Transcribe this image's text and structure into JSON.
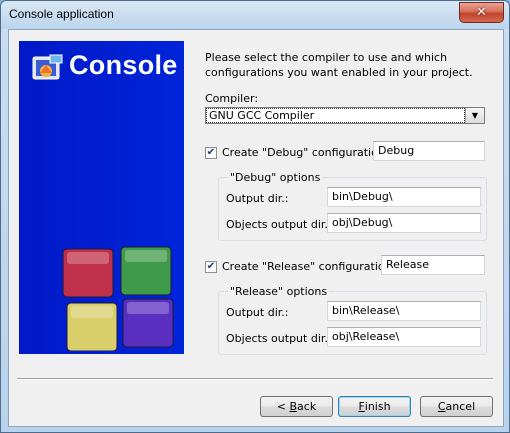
{
  "window": {
    "title": "Console application",
    "close_glyph": "✕"
  },
  "banner": {
    "title": "Console",
    "logo_icon": "codeblocks-logo-icon",
    "cube_colors": [
      "#c0304a",
      "#3f9a4a",
      "#d8cf6a",
      "#5a2fc0"
    ]
  },
  "intro_text": "Please select the compiler to use and which configurations you want enabled in your project.",
  "compiler": {
    "label": "Compiler:",
    "selected": "GNU GCC Compiler"
  },
  "debug": {
    "checkbox_label": "Create \"Debug\" configuration:",
    "checked": true,
    "name_value": "Debug",
    "group_title": "\"Debug\" options",
    "output_dir_label": "Output dir.:",
    "output_dir_value": "bin\\Debug\\",
    "objects_dir_label": "Objects output dir.:",
    "objects_dir_value": "obj\\Debug\\"
  },
  "release": {
    "checkbox_label": "Create \"Release\" configuration:",
    "checked": true,
    "name_value": "Release",
    "group_title": "\"Release\" options",
    "output_dir_label": "Output dir.:",
    "output_dir_value": "bin\\Release\\",
    "objects_dir_label": "Objects output dir.:",
    "objects_dir_value": "obj\\Release\\"
  },
  "buttons": {
    "back_prefix": "< ",
    "back_mnemonic": "B",
    "back_rest": "ack",
    "finish_mnemonic": "F",
    "finish_rest": "inish",
    "cancel_mnemonic": "C",
    "cancel_rest": "ancel"
  }
}
